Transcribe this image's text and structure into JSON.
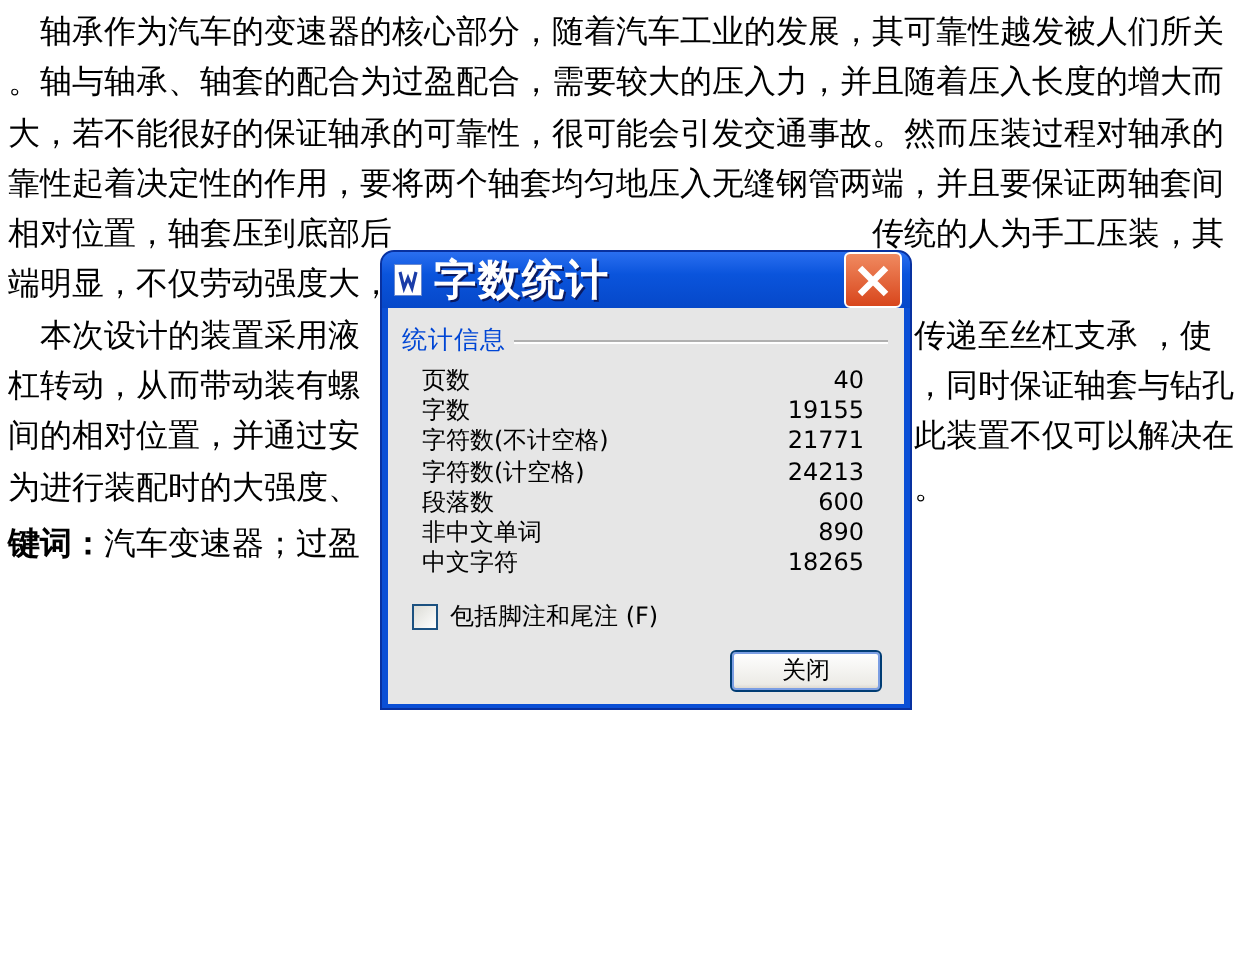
{
  "document": {
    "lines": [
      {
        "kind": "text",
        "indent": true,
        "left": "轴承作为汽车的变速器的核心部分，随着汽车工业的发展，其可靠性越发被人们所关"
      },
      {
        "kind": "text",
        "indent": false,
        "left": "。轴与轴承、轴套的配合为过盈配合，需要较大的压入力，并且随着压入长度的增大而"
      },
      {
        "kind": "text",
        "indent": false,
        "left": "大，若不能很好的保证轴承的可靠性，很可能会引发交通事故。然而压装过程对轴承的"
      },
      {
        "kind": "text",
        "indent": false,
        "left": "靠性起着决定性的作用，要将两个轴套均匀地压入无缝钢管两端，并且要保证两轴套间"
      },
      {
        "kind": "text",
        "indent": false,
        "left": "相对位置，轴套压到底部后",
        "right": "传统的人为手工压装，其"
      },
      {
        "kind": "text",
        "indent": false,
        "left": "端明显，不仅劳动强度大，"
      },
      {
        "kind": "text",
        "indent": true,
        "left": "本次设计的装置采用液",
        "right": "传递至丝杠支承 ，使"
      },
      {
        "kind": "text",
        "indent": false,
        "left": "杠转动，从而带动装有螺",
        "right": "，同时保证轴套与钻孔"
      },
      {
        "kind": "text",
        "indent": false,
        "left": "间的相对位置，并通过安",
        "right": "此装置不仅可以解决在"
      },
      {
        "kind": "text",
        "indent": false,
        "left": "为进行装配时的大强度、",
        "right": "。"
      },
      {
        "kind": "keywords",
        "indent": false,
        "left": "**键词：**汽车变速器；过盈"
      }
    ]
  },
  "dialog": {
    "title": "字数统计",
    "section": "统计信息",
    "stats": [
      {
        "label": "页数",
        "value": "40"
      },
      {
        "label": "字数",
        "value": "19155"
      },
      {
        "label": "字符数(不计空格)",
        "value": "21771"
      },
      {
        "label": "字符数(计空格)",
        "value": "24213"
      },
      {
        "label": "段落数",
        "value": "600"
      },
      {
        "label": "非中文单词",
        "value": "890"
      },
      {
        "label": "中文字符",
        "value": "18265"
      }
    ],
    "include_footnotes": {
      "label": "包括脚注和尾注 (F)",
      "checked": false
    },
    "button": "关闭"
  }
}
